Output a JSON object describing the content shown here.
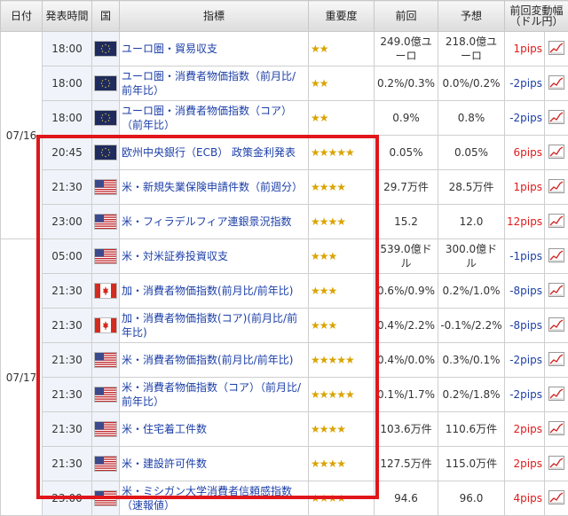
{
  "header": {
    "date": "日付",
    "time": "発表時間",
    "country": "国",
    "indicator": "指標",
    "importance": "重要度",
    "previous": "前回",
    "forecast": "予想",
    "change_line1": "前回変動幅",
    "change_line2": "（ドル円）"
  },
  "dates": [
    "07/16",
    "07/17"
  ],
  "rows": [
    {
      "time": "18:00",
      "flag": "eu-flag-icon",
      "indicator": "ユーロ圏・貿易収支",
      "stars": "★★",
      "previous": "249.0億ユーロ",
      "forecast": "218.0億ユーロ",
      "pips": "1pips",
      "pips_dir": "pos"
    },
    {
      "time": "18:00",
      "flag": "eu-flag-icon",
      "indicator": "ユーロ圏・消費者物価指数（前月比/前年比）",
      "stars": "★★",
      "previous": "0.2%/0.3%",
      "forecast": "0.0%/0.2%",
      "pips": "-2pips",
      "pips_dir": "neg"
    },
    {
      "time": "18:00",
      "flag": "eu-flag-icon",
      "indicator": "ユーロ圏・消費者物価指数（コア）（前年比）",
      "stars": "★★",
      "previous": "0.9%",
      "forecast": "0.8%",
      "pips": "-2pips",
      "pips_dir": "neg"
    },
    {
      "time": "20:45",
      "flag": "eu-flag-icon",
      "indicator": "欧州中央銀行（ECB） 政策金利発表",
      "stars": "★★★★★",
      "previous": "0.05%",
      "forecast": "0.05%",
      "pips": "6pips",
      "pips_dir": "pos"
    },
    {
      "time": "21:30",
      "flag": "us-flag-icon",
      "indicator": "米・新規失業保険申請件数（前週分）",
      "stars": "★★★★",
      "previous": "29.7万件",
      "forecast": "28.5万件",
      "pips": "1pips",
      "pips_dir": "pos"
    },
    {
      "time": "23:00",
      "flag": "us-flag-icon",
      "indicator": "米・フィラデルフィア連銀景況指数",
      "stars": "★★★★",
      "previous": "15.2",
      "forecast": "12.0",
      "pips": "12pips",
      "pips_dir": "pos"
    },
    {
      "time": "05:00",
      "flag": "us-flag-icon",
      "indicator": "米・対米証券投資収支",
      "stars": "★★★",
      "previous": "539.0億ドル",
      "forecast": "300.0億ドル",
      "pips": "-1pips",
      "pips_dir": "neg"
    },
    {
      "time": "21:30",
      "flag": "ca-flag-icon",
      "indicator": "加・消費者物価指数(前月比/前年比)",
      "stars": "★★★",
      "previous": "0.6%/0.9%",
      "forecast": "0.2%/1.0%",
      "pips": "-8pips",
      "pips_dir": "neg"
    },
    {
      "time": "21:30",
      "flag": "ca-flag-icon",
      "indicator": "加・消費者物価指数(コア)(前月比/前年比)",
      "stars": "★★★",
      "previous": "0.4%/2.2%",
      "forecast": "-0.1%/2.2%",
      "pips": "-8pips",
      "pips_dir": "neg"
    },
    {
      "time": "21:30",
      "flag": "us-flag-icon",
      "indicator": "米・消費者物価指数(前月比/前年比)",
      "stars": "★★★★★",
      "previous": "0.4%/0.0%",
      "forecast": "0.3%/0.1%",
      "pips": "-2pips",
      "pips_dir": "neg"
    },
    {
      "time": "21:30",
      "flag": "us-flag-icon",
      "indicator": "米・消費者物価指数（コア）（前月比/前年比）",
      "stars": "★★★★★",
      "previous": "0.1%/1.7%",
      "forecast": "0.2%/1.8%",
      "pips": "-2pips",
      "pips_dir": "neg"
    },
    {
      "time": "21:30",
      "flag": "us-flag-icon",
      "indicator": "米・住宅着工件数",
      "stars": "★★★★",
      "previous": "103.6万件",
      "forecast": "110.6万件",
      "pips": "2pips",
      "pips_dir": "pos"
    },
    {
      "time": "21:30",
      "flag": "us-flag-icon",
      "indicator": "米・建設許可件数",
      "stars": "★★★★",
      "previous": "127.5万件",
      "forecast": "115.0万件",
      "pips": "2pips",
      "pips_dir": "pos"
    },
    {
      "time": "23:00",
      "flag": "us-flag-icon",
      "indicator": "米・ミシガン大学消費者信頼感指数（速報値）",
      "stars": "★★★★",
      "previous": "94.6",
      "forecast": "96.0",
      "pips": "4pips",
      "pips_dir": "pos"
    }
  ],
  "chart_icon": "line-chart-icon",
  "colors": {
    "highlight": "#e0161b",
    "positive": "#e01b1b",
    "negative": "#1c3fa8",
    "star": "#d9a400",
    "link": "#1c3fa8"
  }
}
